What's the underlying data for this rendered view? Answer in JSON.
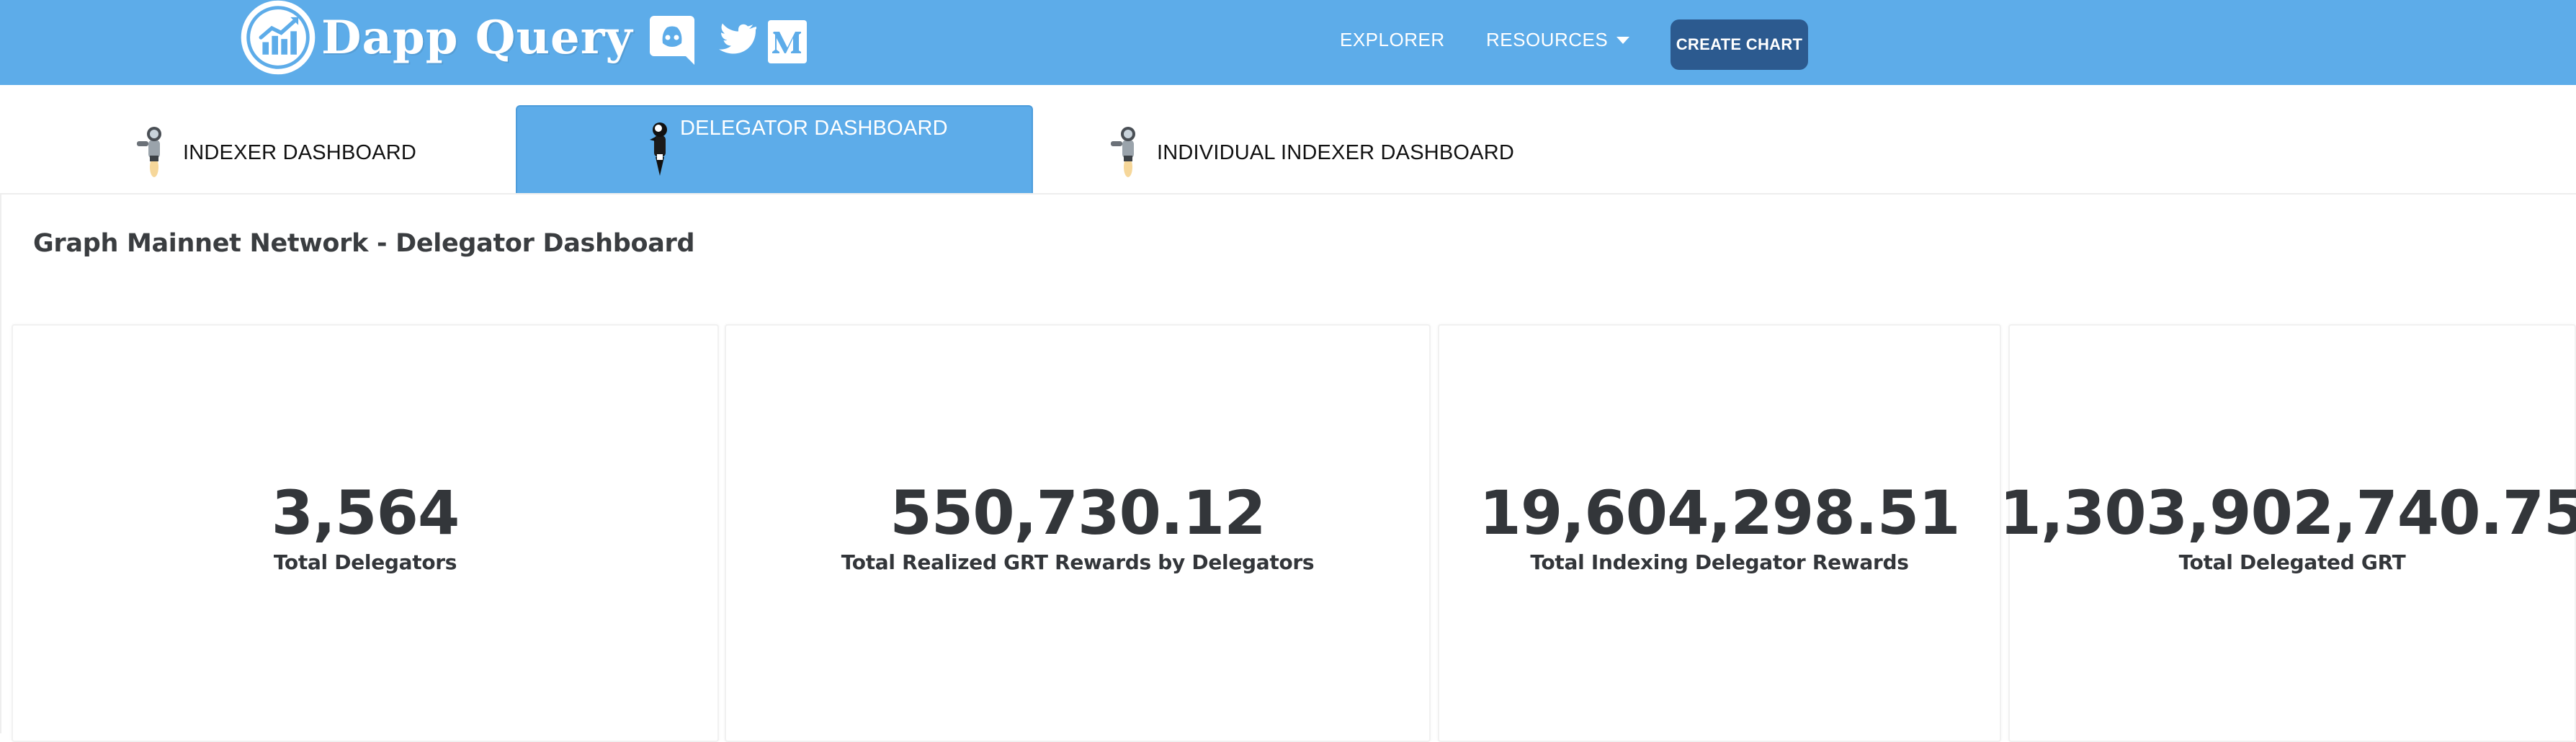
{
  "brand": {
    "name": "Dapp Query",
    "logo_icon": "chart-logo-icon",
    "colors": {
      "navbar": "#5dace9",
      "create_button": "#2c5a8f"
    }
  },
  "social": [
    {
      "icon": "discord-icon"
    },
    {
      "icon": "twitter-icon"
    },
    {
      "icon": "medium-icon"
    }
  ],
  "nav": {
    "explorer_label": "EXPLORER",
    "resources_label": "RESOURCES",
    "create_chart_label": "CREATE CHART"
  },
  "tabs": [
    {
      "label": "INDEXER DASHBOARD",
      "icon": "astronaut-icon",
      "active": false
    },
    {
      "label": "DELEGATOR DASHBOARD",
      "icon": "astronaut-icon",
      "active": true
    },
    {
      "label": "INDIVIDUAL INDEXER DASHBOARD",
      "icon": "astronaut-icon",
      "active": false
    }
  ],
  "page": {
    "title": "Graph Mainnet Network - Delegator Dashboard"
  },
  "stats": [
    {
      "value": "3,564",
      "label": "Total Delegators"
    },
    {
      "value": "550,730.12",
      "label": "Total Realized GRT Rewards by Delegators"
    },
    {
      "value": "19,604,298.51",
      "label": "Total Indexing Delegator Rewards"
    },
    {
      "value": "1,303,902,740.75",
      "label": "Total Delegated GRT"
    }
  ]
}
